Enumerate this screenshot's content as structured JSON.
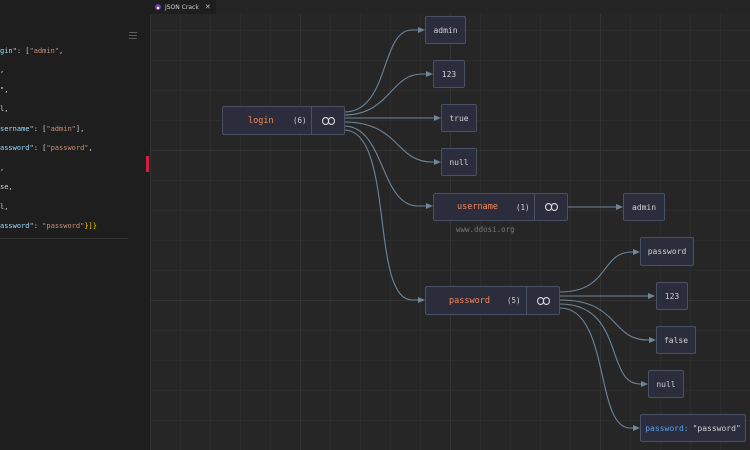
{
  "tab": {
    "title": "JSON Crack",
    "close": "✕"
  },
  "editor": {
    "lines": [
      [
        {
          "c": "k",
          "t": "gin"
        },
        {
          "c": "p",
          "t": "\": ["
        },
        {
          "c": "s",
          "t": "\"admin\""
        },
        {
          "c": "p",
          "t": ","
        }
      ],
      [
        {
          "c": "p",
          "t": ","
        }
      ],
      [
        {
          "c": "p",
          "t": "\","
        }
      ],
      [
        {
          "c": "p",
          "t": "l,"
        }
      ],
      [
        {
          "c": "k",
          "t": "sername"
        },
        {
          "c": "p",
          "t": "\": ["
        },
        {
          "c": "s",
          "t": "\"admin\""
        },
        {
          "c": "p",
          "t": "],"
        }
      ],
      [
        {
          "c": "k",
          "t": "assword"
        },
        {
          "c": "p",
          "t": "\": ["
        },
        {
          "c": "s",
          "t": "\"password\""
        },
        {
          "c": "p",
          "t": ","
        }
      ],
      [
        {
          "c": "p",
          "t": ","
        }
      ],
      [
        {
          "c": "p",
          "t": "se,"
        }
      ],
      [
        {
          "c": "p",
          "t": "l,"
        }
      ],
      [
        {
          "c": "k",
          "t": "assword"
        },
        {
          "c": "p",
          "t": "\": "
        },
        {
          "c": "s",
          "t": "\"password\""
        },
        {
          "c": "b",
          "t": "}]}"
        }
      ]
    ]
  },
  "nodes": {
    "login": {
      "key": "login",
      "count": "(6)"
    },
    "admin1": "admin",
    "n123a": "123",
    "true": "true",
    "null1": "null",
    "username": {
      "key": "username",
      "count": "(1)"
    },
    "admin2": "admin",
    "password": {
      "key": "password",
      "count": "(5)"
    },
    "pw1": "password",
    "n123b": "123",
    "false": "false",
    "null2": "null",
    "pwkv": {
      "key": "password",
      "sep": ":",
      "value": "\"password\""
    }
  },
  "watermark": "www.ddosi.org",
  "colors": {
    "key": "#f08a5d",
    "edge": "#6f8599",
    "node_bg": "#2b2c3c",
    "kv_key": "#5ba2e8"
  }
}
